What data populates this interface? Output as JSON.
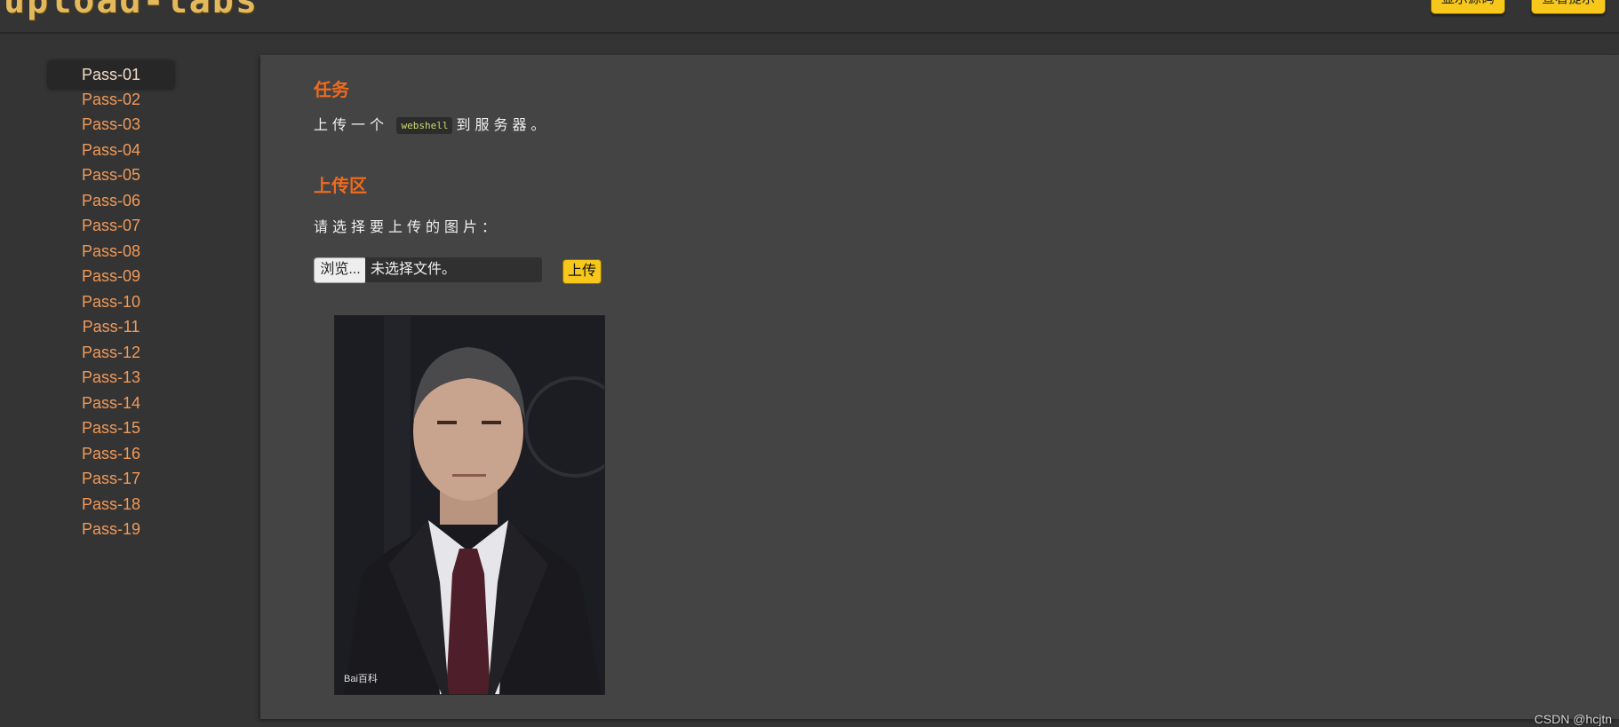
{
  "header": {
    "logo_text": "upload-labs",
    "buttons": [
      {
        "label": "显示源码"
      },
      {
        "label": "查看提示"
      }
    ],
    "accent_color": "#f7c81b"
  },
  "sidebar": {
    "items": [
      {
        "label": "Pass-01",
        "active": true
      },
      {
        "label": "Pass-02"
      },
      {
        "label": "Pass-03"
      },
      {
        "label": "Pass-04"
      },
      {
        "label": "Pass-05"
      },
      {
        "label": "Pass-06"
      },
      {
        "label": "Pass-07"
      },
      {
        "label": "Pass-08"
      },
      {
        "label": "Pass-09"
      },
      {
        "label": "Pass-10"
      },
      {
        "label": "Pass-11"
      },
      {
        "label": "Pass-12"
      },
      {
        "label": "Pass-13"
      },
      {
        "label": "Pass-14"
      },
      {
        "label": "Pass-15"
      },
      {
        "label": "Pass-16"
      },
      {
        "label": "Pass-17"
      },
      {
        "label": "Pass-18"
      },
      {
        "label": "Pass-19"
      }
    ],
    "link_color": "#f19a5a"
  },
  "main": {
    "task_heading": "任务",
    "task_text_before": "上传一个",
    "task_code": "webshell",
    "task_text_after": "到服务器。",
    "upload_heading": "上传区",
    "upload_prompt": "请选择要上传的图片：",
    "file_input": {
      "browse_label": "浏览...",
      "status": "未选择文件。"
    },
    "upload_button": "上传",
    "uploaded_image": {
      "alt": "uploaded portrait photo",
      "watermark": "Bai百科"
    },
    "heading_color": "#f06a1c"
  },
  "footer": {
    "watermark": "CSDN @hcjtn"
  }
}
